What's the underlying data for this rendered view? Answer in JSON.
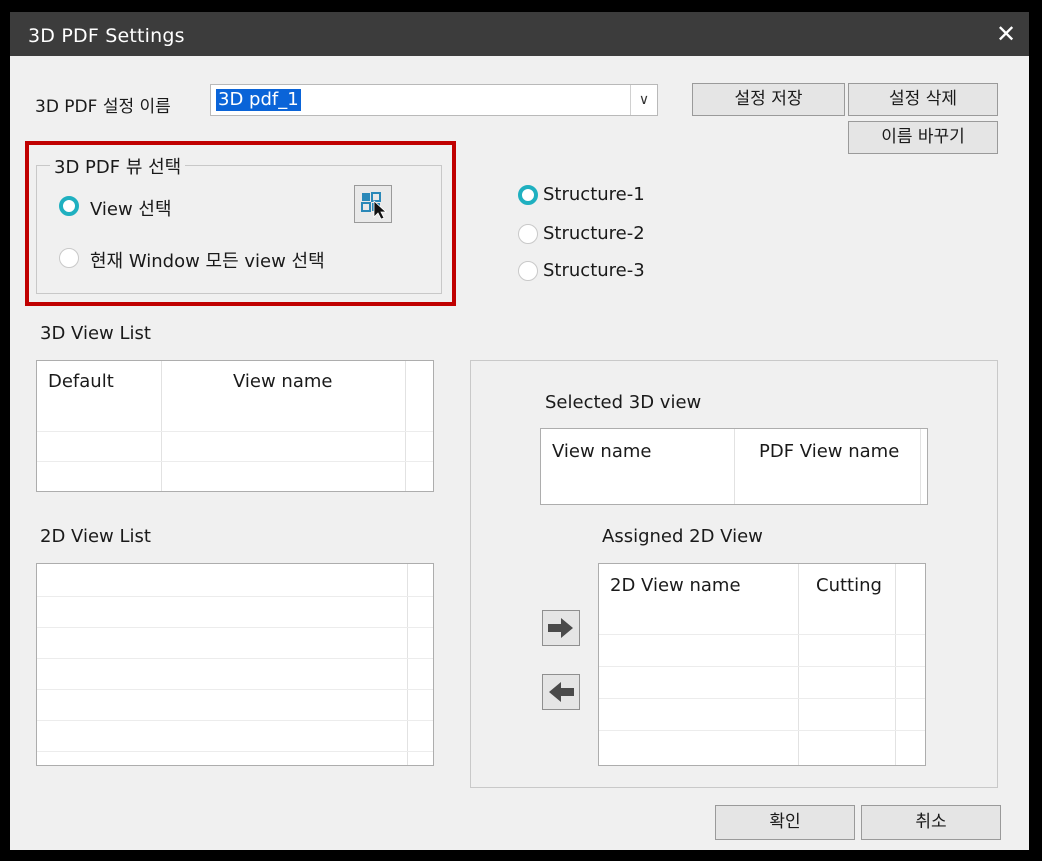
{
  "window": {
    "title": "3D PDF Settings",
    "close_glyph": "✕"
  },
  "settings": {
    "name_label": "3D PDF 설정 이름",
    "name_value": "3D pdf_1",
    "save_label": "설정 저장",
    "delete_label": "설정 삭제",
    "rename_label": "이름 바꾸기"
  },
  "view_select": {
    "group_title": "3D PDF 뷰 선택",
    "option_view": "View 선택",
    "option_all": "현재 Window 모든 view 선택",
    "selected": "View 선택"
  },
  "structures": {
    "options": [
      "Structure-1",
      "Structure-2",
      "Structure-3"
    ],
    "selected": "Structure-1"
  },
  "view_list_3d": {
    "title": "3D View List",
    "columns": [
      "Default",
      "View name"
    ]
  },
  "view_list_2d": {
    "title": "2D View List"
  },
  "selected_3d": {
    "title": "Selected 3D view",
    "columns": [
      "View name",
      "PDF View name"
    ]
  },
  "assigned_2d": {
    "title": "Assigned 2D View",
    "columns": [
      "2D View name",
      "Cutting"
    ]
  },
  "footer": {
    "ok_label": "확인",
    "cancel_label": "취소"
  },
  "colors": {
    "radio_accent": "#1fb0c0",
    "highlight_box": "#c00000",
    "title_bar": "#3c3c3c"
  }
}
